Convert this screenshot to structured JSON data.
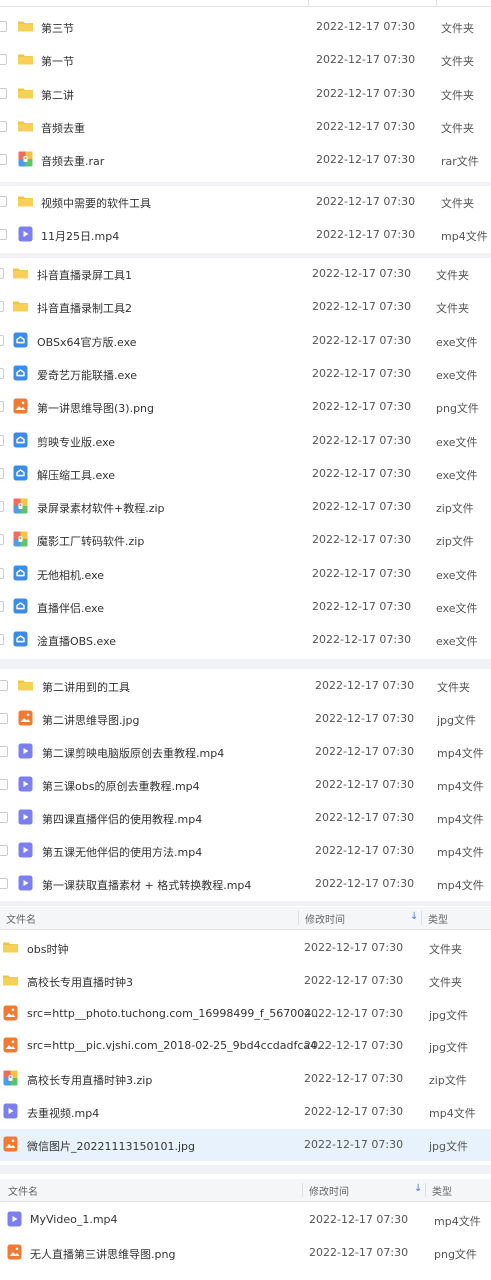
{
  "colors": {
    "folder": "#f5c342",
    "exe": "#3b8beb",
    "video": "#7b7ff0",
    "image": "#f07a33",
    "selected": "#e8f2fc"
  },
  "header1": {
    "col_name": "文件名",
    "col_time": "修改时间",
    "sort_icon": "arrow-down-icon",
    "col_type": "类型"
  },
  "header2": {
    "col_name": "文件名",
    "col_time": "修改时间",
    "sort_icon": "arrow-down-icon",
    "col_type": "类型"
  },
  "group1": [
    {
      "name": "第三节",
      "time": "2022-12-17 07:30",
      "type": "文件夹",
      "icon": "folder-icon"
    },
    {
      "name": "第一节",
      "time": "2022-12-17 07:30",
      "type": "文件夹",
      "icon": "folder-icon"
    },
    {
      "name": "第二讲",
      "time": "2022-12-17 07:30",
      "type": "文件夹",
      "icon": "folder-icon"
    },
    {
      "name": "音频去重",
      "time": "2022-12-17 07:30",
      "type": "文件夹",
      "icon": "folder-icon"
    },
    {
      "name": "音频去重.rar",
      "time": "2022-12-17 07:30",
      "type": "rar文件",
      "icon": "archive-icon"
    }
  ],
  "group2": [
    {
      "name": "视频中需要的软件工具",
      "time": "2022-12-17 07:30",
      "type": "文件夹",
      "icon": "folder-icon"
    },
    {
      "name": "11月25日.mp4",
      "time": "2022-12-17 07:30",
      "type": "mp4文件",
      "icon": "video-icon"
    }
  ],
  "group3": [
    {
      "name": "抖音直播录屏工具1",
      "time": "2022-12-17 07:30",
      "type": "文件夹",
      "icon": "folder-icon"
    },
    {
      "name": "抖音直播录制工具2",
      "time": "2022-12-17 07:30",
      "type": "文件夹",
      "icon": "folder-icon"
    },
    {
      "name": "OBSx64官方版.exe",
      "time": "2022-12-17 07:30",
      "type": "exe文件",
      "icon": "exe-icon"
    },
    {
      "name": "爱奇艺万能联播.exe",
      "time": "2022-12-17 07:30",
      "type": "exe文件",
      "icon": "exe-icon"
    },
    {
      "name": "第一讲思维导图(3).png",
      "time": "2022-12-17 07:30",
      "type": "png文件",
      "icon": "image-icon"
    },
    {
      "name": "剪映专业版.exe",
      "time": "2022-12-17 07:30",
      "type": "exe文件",
      "icon": "exe-icon"
    },
    {
      "name": "解压缩工具.exe",
      "time": "2022-12-17 07:30",
      "type": "exe文件",
      "icon": "exe-icon"
    },
    {
      "name": "录屏录素材软件+教程.zip",
      "time": "2022-12-17 07:30",
      "type": "zip文件",
      "icon": "archive-icon"
    },
    {
      "name": "魔影工厂转码软件.zip",
      "time": "2022-12-17 07:30",
      "type": "zip文件",
      "icon": "archive-icon"
    },
    {
      "name": "无他相机.exe",
      "time": "2022-12-17 07:30",
      "type": "exe文件",
      "icon": "exe-icon"
    },
    {
      "name": "直播伴侣.exe",
      "time": "2022-12-17 07:30",
      "type": "exe文件",
      "icon": "exe-icon"
    },
    {
      "name": "淦直播OBS.exe",
      "time": "2022-12-17 07:30",
      "type": "exe文件",
      "icon": "exe-icon"
    }
  ],
  "group4": [
    {
      "name": "第二讲用到的工具",
      "time": "2022-12-17 07:30",
      "type": "文件夹",
      "icon": "folder-icon"
    },
    {
      "name": "第二讲思维导图.jpg",
      "time": "2022-12-17 07:30",
      "type": "jpg文件",
      "icon": "image-icon"
    },
    {
      "name": "第二课剪映电脑版原创去重教程.mp4",
      "time": "2022-12-17 07:30",
      "type": "mp4文件",
      "icon": "video-icon"
    },
    {
      "name": "第三课obs的原创去重教程.mp4",
      "time": "2022-12-17 07:30",
      "type": "mp4文件",
      "icon": "video-icon"
    },
    {
      "name": "第四课直播伴侣的使用教程.mp4",
      "time": "2022-12-17 07:30",
      "type": "mp4文件",
      "icon": "video-icon"
    },
    {
      "name": "第五课无他伴侣的使用方法.mp4",
      "time": "2022-12-17 07:30",
      "type": "mp4文件",
      "icon": "video-icon"
    },
    {
      "name": "第一课获取直播素材 + 格式转换教程.mp4",
      "time": "2022-12-17 07:30",
      "type": "mp4文件",
      "icon": "video-icon"
    }
  ],
  "group5": [
    {
      "name": "obs时钟",
      "time": "2022-12-17 07:30",
      "type": "文件夹",
      "icon": "folder-icon"
    },
    {
      "name": "高校长专用直播时钟3",
      "time": "2022-12-17 07:30",
      "type": "文件夹",
      "icon": "folder-icon"
    },
    {
      "name": "src=http__photo.tuchong.com_16998499_f_567004...",
      "time": "2022-12-17 07:30",
      "type": "jpg文件",
      "icon": "image-icon"
    },
    {
      "name": "src=http__pic.vjshi.com_2018-02-25_9bd4ccdadfca4...",
      "time": "2022-12-17 07:30",
      "type": "jpg文件",
      "icon": "image-icon"
    },
    {
      "name": "高校长专用直播时钟3.zip",
      "time": "2022-12-17 07:30",
      "type": "zip文件",
      "icon": "archive-icon"
    },
    {
      "name": "去重视频.mp4",
      "time": "2022-12-17 07:30",
      "type": "mp4文件",
      "icon": "video-icon"
    },
    {
      "name": "微信图片_20221113150101.jpg",
      "time": "2022-12-17 07:30",
      "type": "jpg文件",
      "icon": "image-icon",
      "selected": true
    }
  ],
  "group6": [
    {
      "name": "MyVideo_1.mp4",
      "time": "2022-12-17 07:30",
      "type": "mp4文件",
      "icon": "video-icon"
    },
    {
      "name": "无人直播第三讲思维导图.png",
      "time": "2022-12-17 07:30",
      "type": "png文件",
      "icon": "image-icon"
    }
  ]
}
